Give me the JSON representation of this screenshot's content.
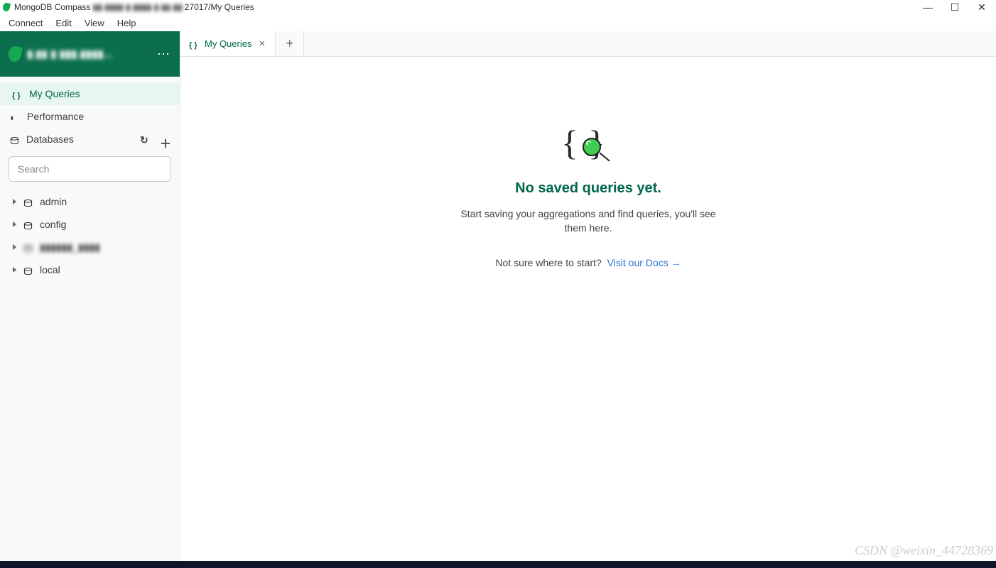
{
  "window": {
    "title_prefix": "MongoDB Compass",
    "title_host_blurred": "▮▮ ▮▮▮▮  ▮.▮▮▮▮  ▮  ▮▮.▮▮:",
    "title_suffix": "27017/My Queries"
  },
  "menus": [
    "Connect",
    "Edit",
    "View",
    "Help"
  ],
  "sidebar": {
    "conn_name_blurred": "▮.▮▮ ▮ ▮▮▮.▮▮▮▮...",
    "items": {
      "my_queries": "My Queries",
      "performance": "Performance",
      "databases": "Databases"
    },
    "search_placeholder": "Search",
    "dbs": [
      "admin",
      "config",
      "▮▮▮▮▮▮_▮▮▮▮",
      "local"
    ]
  },
  "tab": {
    "label": "My Queries"
  },
  "empty": {
    "title": "No saved queries yet.",
    "sub": "Start saving your aggregations and find queries, you'll see them here.",
    "hint": "Not sure where to start?",
    "link": "Visit our Docs"
  },
  "watermark": "CSDN @weixin_44728369"
}
